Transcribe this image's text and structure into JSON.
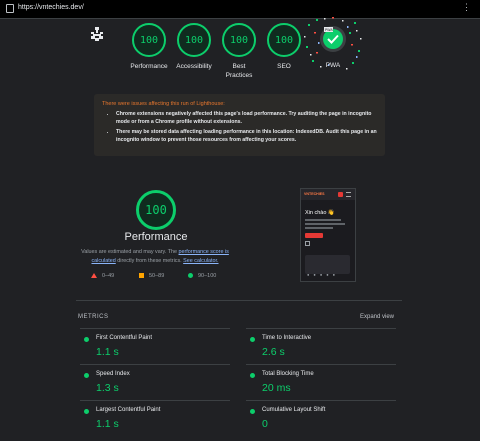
{
  "browser": {
    "url": "https://vntechies.dev/"
  },
  "scores": [
    {
      "label": "Performance",
      "score": "100"
    },
    {
      "label": "Accessibility",
      "score": "100"
    },
    {
      "label": "Best Practices",
      "score": "100"
    },
    {
      "label": "SEO",
      "score": "100"
    },
    {
      "label": "PWA",
      "score": ""
    }
  ],
  "warnings": {
    "title": "There were issues affecting this run of Lighthouse:",
    "items": [
      "Chrome extensions negatively affected this page's load performance. Try auditing the page in incognito mode or from a Chrome profile without extensions.",
      "There may be stored data affecting loading performance in this location: IndexedDB. Audit this page in an incognito window to prevent those resources from affecting your scores."
    ]
  },
  "performance": {
    "score": "100",
    "title": "Performance",
    "desc_pre": "Values are estimated and may vary. The ",
    "desc_link1": "performance score is calculated",
    "desc_mid": " directly from these metrics. ",
    "desc_link2": "See calculator."
  },
  "legend": {
    "fail": "0–49",
    "average": "50–89",
    "pass": "90–100"
  },
  "thumbnail": {
    "brand": "VNTECHIES",
    "greeting": "Xin chào 👋"
  },
  "metrics": {
    "heading": "METRICS",
    "expand_label": "Expand view",
    "items": [
      {
        "label": "First Contentful Paint",
        "value": "1.1 s"
      },
      {
        "label": "Time to Interactive",
        "value": "2.6 s"
      },
      {
        "label": "Speed Index",
        "value": "1.3 s"
      },
      {
        "label": "Total Blocking Time",
        "value": "20 ms"
      },
      {
        "label": "Largest Contentful Paint",
        "value": "1.1 s"
      },
      {
        "label": "Cumulative Layout Shift",
        "value": "0"
      }
    ]
  },
  "colors": {
    "pass": "#0cce6b",
    "average": "#ffa400",
    "fail": "#ff4e42",
    "warning": "#e8772e",
    "link": "#8ab4f8"
  },
  "icons": [
    "page-icon",
    "kebab-menu-icon",
    "lighthouse-logo-icon",
    "pwa-badge-icon"
  ]
}
